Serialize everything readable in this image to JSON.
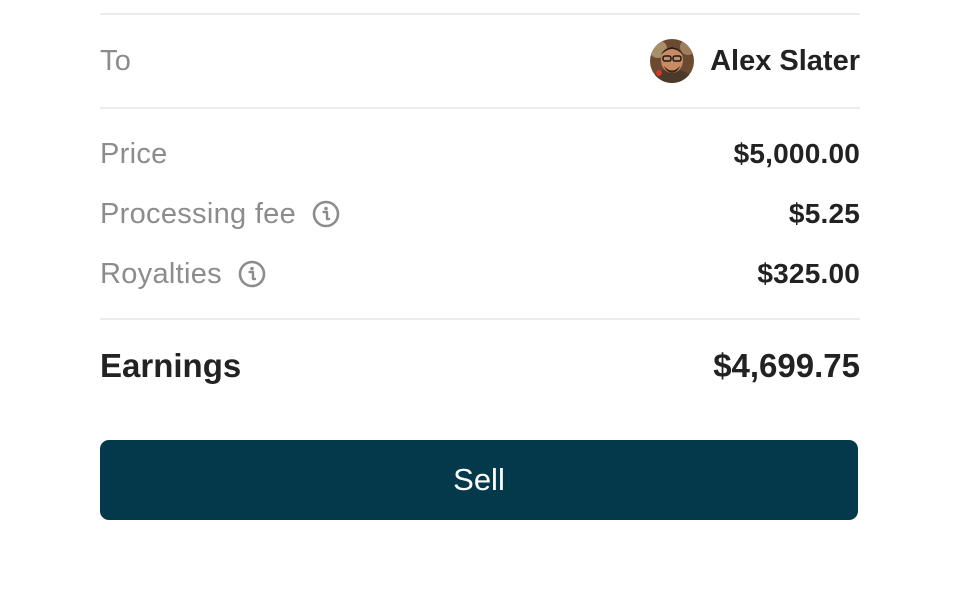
{
  "recipient": {
    "label": "To",
    "name": "Alex Slater",
    "avatar_icon": "user-avatar"
  },
  "breakdown": {
    "items": [
      {
        "label": "Price",
        "value": "$5,000.00",
        "has_info": false
      },
      {
        "label": "Processing fee",
        "value": "$5.25",
        "has_info": true,
        "icon": "info-icon"
      },
      {
        "label": "Royalties",
        "value": "$325.00",
        "has_info": true,
        "icon": "info-icon"
      }
    ]
  },
  "earnings": {
    "label": "Earnings",
    "value": "$4,699.75"
  },
  "actions": {
    "sell_label": "Sell"
  },
  "colors": {
    "button_background": "#03394a",
    "button_text": "#ffffff",
    "muted_text": "#8c8c8c",
    "primary_text": "#222222",
    "divider": "#ececec"
  }
}
